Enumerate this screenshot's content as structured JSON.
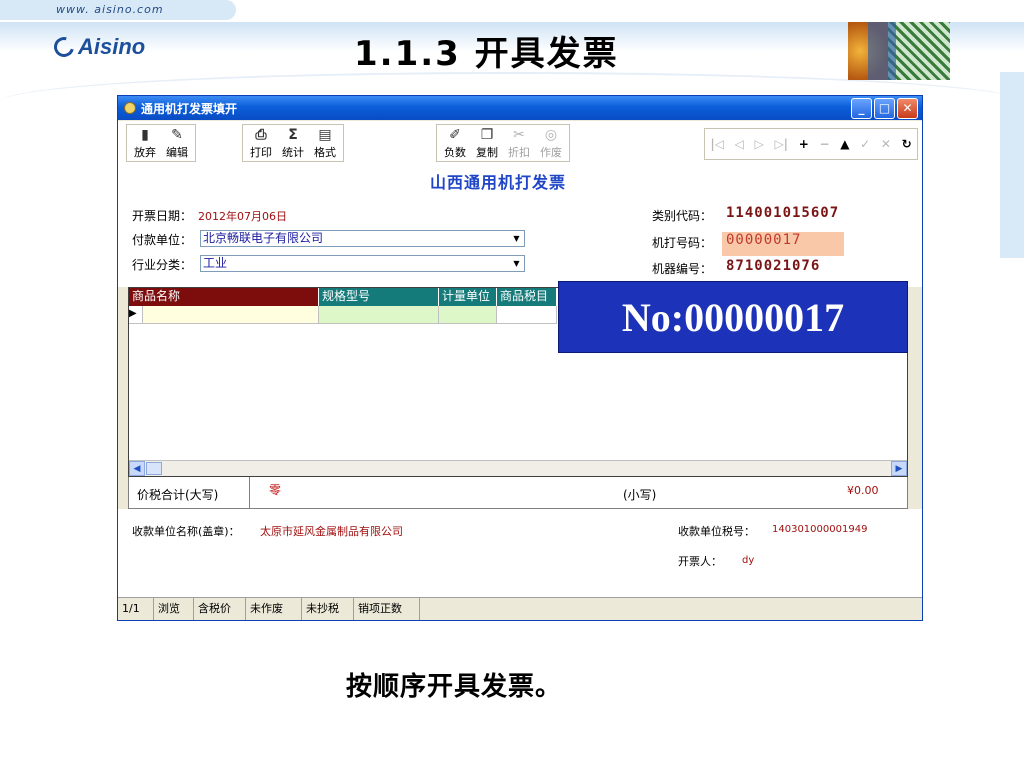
{
  "slide": {
    "website": "www. aisino.com",
    "logo": "Aisino",
    "title": "1.1.3 开具发票",
    "caption": "按顺序开具发票。"
  },
  "window": {
    "title": "通用机打发票填开",
    "controls": {
      "minimize": "_",
      "maximize": "□",
      "close": "✕"
    }
  },
  "toolbar": {
    "group1": [
      {
        "label": "放弃",
        "icon": "discard-icon",
        "glyph": "▮",
        "enabled": true
      },
      {
        "label": "编辑",
        "icon": "edit-icon",
        "glyph": "✎",
        "enabled": true
      }
    ],
    "group2": [
      {
        "label": "打印",
        "icon": "print-icon",
        "glyph": "⎙",
        "enabled": true
      },
      {
        "label": "统计",
        "icon": "sum-icon",
        "glyph": "Σ",
        "enabled": true
      },
      {
        "label": "格式",
        "icon": "format-icon",
        "glyph": "▤",
        "enabled": true
      }
    ],
    "group3": [
      {
        "label": "负数",
        "icon": "negative-icon",
        "glyph": "✐",
        "enabled": true
      },
      {
        "label": "复制",
        "icon": "copy-icon",
        "glyph": "❐",
        "enabled": true
      },
      {
        "label": "折扣",
        "icon": "discount-icon",
        "glyph": "✂",
        "enabled": false
      },
      {
        "label": "作废",
        "icon": "void-icon",
        "glyph": "◎",
        "enabled": false
      }
    ],
    "nav": [
      {
        "icon": "first-record-icon",
        "glyph": "|◁",
        "enabled": false
      },
      {
        "icon": "prev-record-icon",
        "glyph": "◁",
        "enabled": false
      },
      {
        "icon": "next-record-icon",
        "glyph": "▷",
        "enabled": false
      },
      {
        "icon": "last-record-icon",
        "glyph": "▷|",
        "enabled": false
      },
      {
        "icon": "add-record-icon",
        "glyph": "+",
        "enabled": true
      },
      {
        "icon": "delete-record-icon",
        "glyph": "−",
        "enabled": false
      },
      {
        "icon": "up-icon",
        "glyph": "▲",
        "enabled": true
      },
      {
        "icon": "confirm-icon",
        "glyph": "✓",
        "enabled": false
      },
      {
        "icon": "cancel-icon",
        "glyph": "✕",
        "enabled": false
      },
      {
        "icon": "refresh-icon",
        "glyph": "↻",
        "enabled": true
      }
    ]
  },
  "invoice": {
    "heading": "山西通用机打发票",
    "date_label": "开票日期：",
    "date_value": "2012年07月06日",
    "payer_label": "付款单位：",
    "payer_value": "北京畅联电子有限公司",
    "industry_label": "行业分类：",
    "industry_value": "工业",
    "category_code_label": "类别代码：",
    "category_code_value": "114001015607",
    "machine_no_label": "机打号码：",
    "machine_no_value": "00000017",
    "machine_id_label": "机器编号：",
    "machine_id_value": "8710021076"
  },
  "grid": {
    "columns": [
      {
        "label": "商品名称",
        "color": "#7d0d0d"
      },
      {
        "label": "规格型号",
        "color": "#157a7a"
      },
      {
        "label": "计量单位",
        "color": "#157a7a"
      },
      {
        "label": "商品税目",
        "color": "#157a7a"
      }
    ]
  },
  "banner": "No:00000017",
  "totals": {
    "label": "价税合计(大写)",
    "upper_value": "零",
    "lower_label": "(小写)",
    "lower_value": "¥0.00"
  },
  "footer": {
    "payee_label": "收款单位名称(盖章)：",
    "payee_value": "太原市延风金属制品有限公司",
    "tax_id_label": "收款单位税号：",
    "tax_id_value": "140301000001949",
    "issuer_label": "开票人：",
    "issuer_value": "dy"
  },
  "status": [
    "1/1",
    "浏览",
    "含税价",
    "未作废",
    "未抄税",
    "销项正数"
  ]
}
